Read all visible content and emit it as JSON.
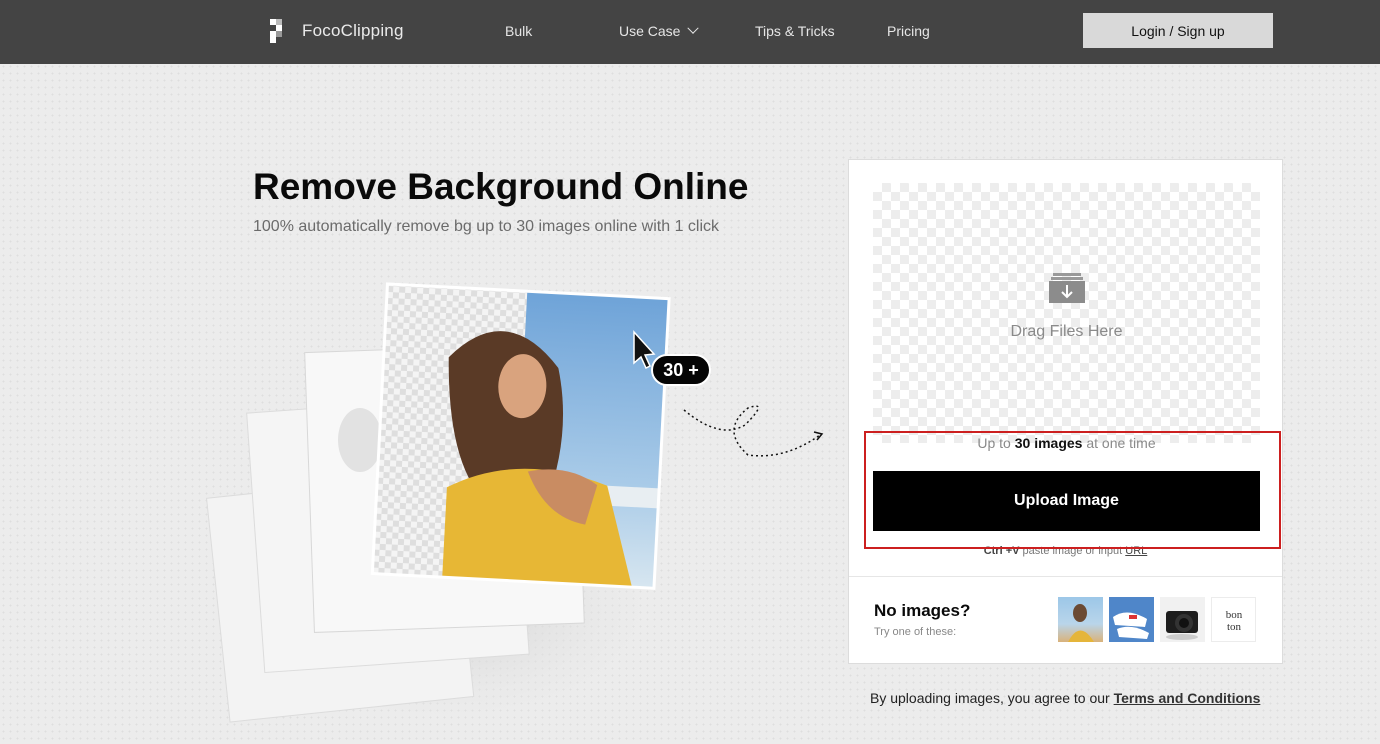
{
  "nav": {
    "logo_text": "FocoClipping",
    "items": [
      {
        "label": "Bulk"
      },
      {
        "label": "Use Case"
      },
      {
        "label": "Tips & Tricks"
      },
      {
        "label": "Pricing"
      }
    ],
    "login_label": "Login / Sign up"
  },
  "hero": {
    "title": "Remove Background Online",
    "subtitle": "100% automatically remove bg up to 30 images online with 1 click",
    "badge": "30 +"
  },
  "upload": {
    "drag_text": "Drag Files Here",
    "limit_prefix": "Up to ",
    "limit_bold": "30 images",
    "limit_suffix": " at one time",
    "button_label": "Upload Image",
    "paste_shortcut": "Ctrl +V",
    "paste_text": " paste image or input ",
    "paste_link": "URL"
  },
  "samples": {
    "title": "No images?",
    "subtitle": "Try one of these:",
    "items": [
      {
        "icon": "woman-sample-image"
      },
      {
        "icon": "sneakers-sample-image"
      },
      {
        "icon": "camera-sample-image"
      },
      {
        "icon": "bonton-logo-sample-image",
        "text": "bon ton"
      }
    ]
  },
  "footer": {
    "terms_prefix": "By uploading images, you agree to our ",
    "terms_link": "Terms and Conditions"
  },
  "colors": {
    "nav_bg": "#444444",
    "button_bg": "#000000",
    "highlight": "#cc1f1f",
    "login_bg": "#d9d9d9"
  }
}
